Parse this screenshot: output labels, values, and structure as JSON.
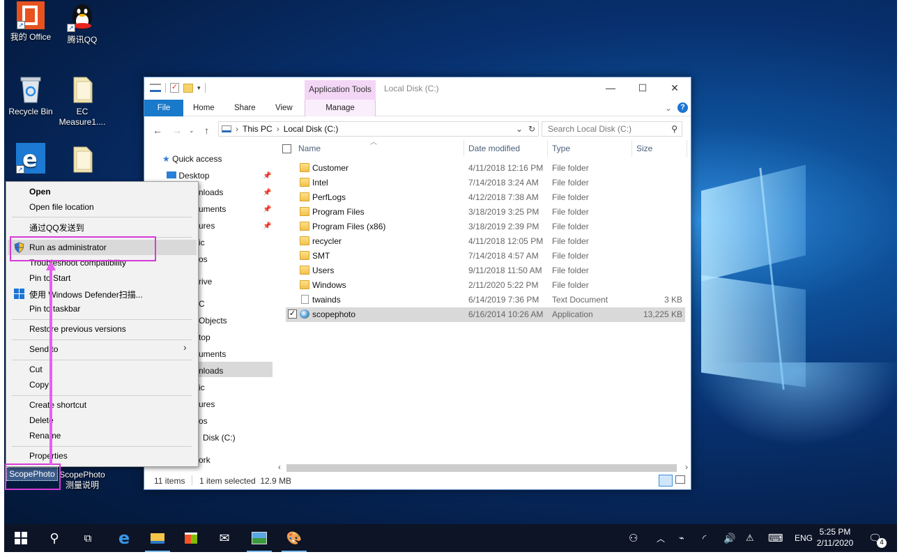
{
  "desktop": {
    "icons": [
      {
        "label": "我的 Office",
        "icon": "office-icon"
      },
      {
        "label": "腾讯QQ",
        "icon": "qq-icon"
      },
      {
        "label": "Recycle Bin",
        "icon": "recycle-bin-icon"
      },
      {
        "label": "EC Measure1....",
        "icon": "file-icon"
      },
      {
        "label": "",
        "icon": "edge-icon"
      },
      {
        "label": "",
        "icon": "file-icon"
      }
    ],
    "scopephoto_label": "ScopePhoto",
    "scopephoto_doc_label": "ScopePhoto 测量说明"
  },
  "explorer": {
    "title": "Local Disk (C:)",
    "context_tab": "Application Tools",
    "ribbon_tabs": [
      "File",
      "Home",
      "Share",
      "View",
      "Manage"
    ],
    "address": {
      "segments": [
        "This PC",
        "Local Disk (C:)"
      ]
    },
    "search_placeholder": "Search Local Disk (C:)",
    "nav": {
      "quick_access": "Quick access",
      "items": [
        "Desktop",
        "nloads",
        "uments",
        "ures",
        "ic",
        "os",
        "rive",
        "C",
        "Objects",
        "top",
        "uments",
        "nloads",
        "ic",
        "ures",
        "os",
        "Disk (C:)",
        "ork"
      ]
    },
    "columns": [
      "Name",
      "Date modified",
      "Type",
      "Size"
    ],
    "files": [
      {
        "name": "Customer",
        "date": "4/11/2018 12:16 PM",
        "type": "File folder",
        "size": "",
        "kind": "folder"
      },
      {
        "name": "Intel",
        "date": "7/14/2018 3:24 AM",
        "type": "File folder",
        "size": "",
        "kind": "folder"
      },
      {
        "name": "PerfLogs",
        "date": "4/12/2018 7:38 AM",
        "type": "File folder",
        "size": "",
        "kind": "folder"
      },
      {
        "name": "Program Files",
        "date": "3/18/2019 3:25 PM",
        "type": "File folder",
        "size": "",
        "kind": "folder"
      },
      {
        "name": "Program Files (x86)",
        "date": "3/18/2019 2:39 PM",
        "type": "File folder",
        "size": "",
        "kind": "folder"
      },
      {
        "name": "recycler",
        "date": "4/11/2018 12:05 PM",
        "type": "File folder",
        "size": "",
        "kind": "folder"
      },
      {
        "name": "SMT",
        "date": "7/14/2018 4:57 AM",
        "type": "File folder",
        "size": "",
        "kind": "folder"
      },
      {
        "name": "Users",
        "date": "9/11/2018 11:50 AM",
        "type": "File folder",
        "size": "",
        "kind": "folder"
      },
      {
        "name": "Windows",
        "date": "2/11/2020 5:22 PM",
        "type": "File folder",
        "size": "",
        "kind": "folder"
      },
      {
        "name": "twainds",
        "date": "6/14/2019 7:36 PM",
        "type": "Text Document",
        "size": "3 KB",
        "kind": "text"
      },
      {
        "name": "scopephoto",
        "date": "6/16/2014 10:26 AM",
        "type": "Application",
        "size": "13,225 KB",
        "kind": "app"
      }
    ],
    "status": {
      "count": "11 items",
      "selection": "1 item selected  12.9 MB"
    }
  },
  "context_menu": {
    "items": [
      {
        "label": "Open",
        "bold": true
      },
      {
        "label": "Open file location"
      },
      {
        "label": "通过QQ发送到"
      },
      {
        "label": "Run as administrator"
      },
      {
        "label": "Troubleshoot compatibility"
      },
      {
        "label": "Pin to Start"
      },
      {
        "label": "使用 Windows Defender扫描..."
      },
      {
        "label": "Pin to taskbar"
      },
      {
        "label": "Restore previous versions"
      },
      {
        "label": "Send to"
      },
      {
        "label": "Cut"
      },
      {
        "label": "Copy"
      },
      {
        "label": "Create shortcut"
      },
      {
        "label": "Delete"
      },
      {
        "label": "Rename"
      },
      {
        "label": "Properties"
      }
    ]
  },
  "taskbar": {
    "language": "ENG",
    "time": "5:25 PM",
    "date": "2/11/2020",
    "notifications": "4"
  },
  "colors": {
    "accent": "#1979ca",
    "highlight": "#d63bd8",
    "taskbar": "#0c1426"
  }
}
